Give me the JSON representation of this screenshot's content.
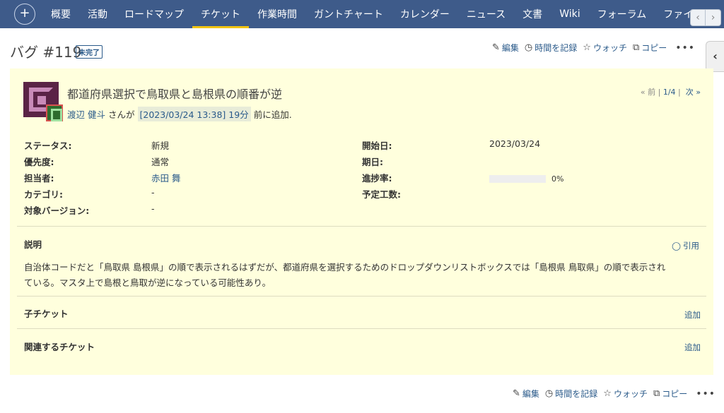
{
  "nav": {
    "plus": "+",
    "tabs": [
      "概要",
      "活動",
      "ロードマップ",
      "チケット",
      "作業時間",
      "ガントチャート",
      "カレンダー",
      "ニュース",
      "文書",
      "Wiki",
      "フォーラム",
      "ファイル"
    ],
    "active_tab": "チケット",
    "scroll_left": "‹",
    "scroll_right": "›"
  },
  "sidebar_toggle": "‹",
  "issue": {
    "title": "バグ #119",
    "status_badge": "未完了",
    "subject": "都道府県選択で鳥取県と島根県の順番が逆",
    "author_name": "渡辺 健斗",
    "author_suffix": "さんが",
    "created": "[2023/03/24 13:38] 19分",
    "created_suffix": "前に追加.",
    "prev": "« 前",
    "sep1": "|",
    "position": "1/4",
    "sep2": "|",
    "next": "次 »"
  },
  "actions": {
    "edit": "編集",
    "log_time": "時間を記録",
    "watch": "ウォッチ",
    "copy": "コピー",
    "more": "•••"
  },
  "attributes": {
    "status_label": "ステータス:",
    "status_value": "新規",
    "priority_label": "優先度:",
    "priority_value": "通常",
    "assignee_label": "担当者:",
    "assignee_value": "赤田 舞",
    "category_label": "カテゴリ:",
    "category_value": "-",
    "version_label": "対象バージョン:",
    "version_value": "-",
    "start_label": "開始日:",
    "start_value": "2023/03/24",
    "due_label": "期日:",
    "due_value": "",
    "progress_label": "進捗率:",
    "progress_value": "0%",
    "progress_fraction": 0,
    "estimate_label": "予定工数:",
    "estimate_value": ""
  },
  "description": {
    "title": "説明",
    "quote": "引用",
    "text_line1": "自治体コードだと「鳥取県 島根県」の順で表示されるはずだが、都道府県を選択するためのドロップダウンリストボックスでは「島根県 鳥取県」の順で表示され",
    "text_line2": "ている。マスタ上で島根と鳥取が逆になっている可能性あり。"
  },
  "subtasks": {
    "title": "子チケット",
    "add": "追加"
  },
  "relations": {
    "title": "関連するチケット",
    "add": "追加"
  }
}
